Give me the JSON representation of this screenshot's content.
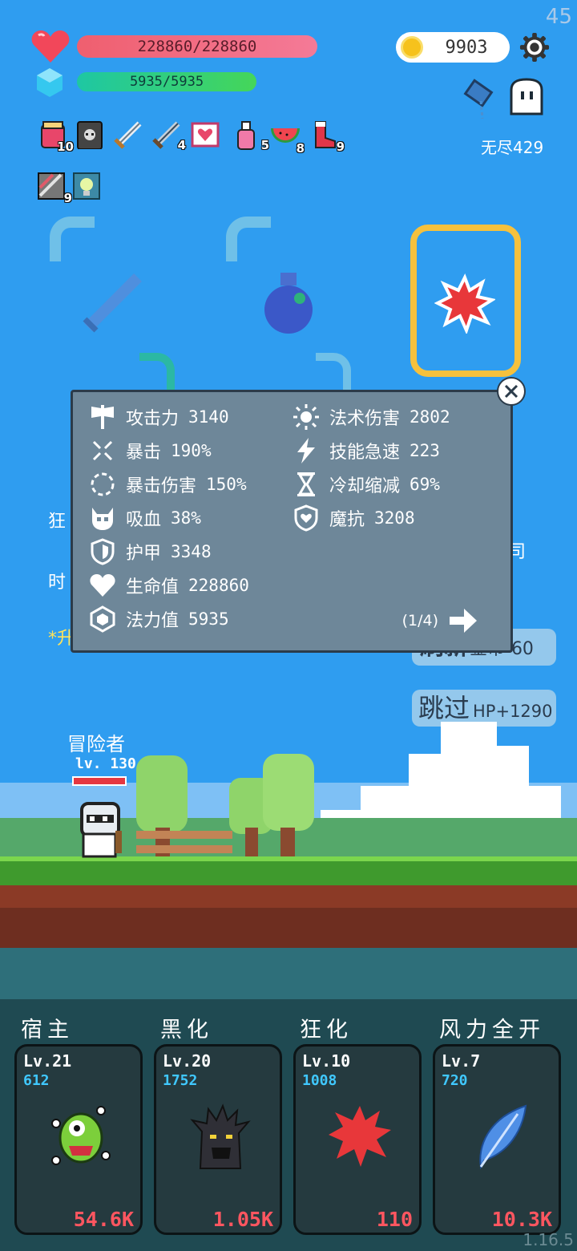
{
  "fps": "45",
  "version": "1.16.5",
  "player": {
    "hp_text": "228860/228860",
    "mp_text": "5935/5935",
    "hp_fill": 1.0,
    "mp_fill": 1.0
  },
  "coins": "9903",
  "endless_label": "无尽429",
  "items": [
    {
      "icon": "potion-jar-icon",
      "count": "10"
    },
    {
      "icon": "skull-book-icon",
      "count": ""
    },
    {
      "icon": "sword-icon",
      "count": ""
    },
    {
      "icon": "sword-icon",
      "count": "4"
    },
    {
      "icon": "heart-card-icon",
      "count": ""
    },
    {
      "icon": "pink-bottle-icon",
      "count": "5"
    },
    {
      "icon": "watermelon-icon",
      "count": "8"
    },
    {
      "icon": "red-boot-icon",
      "count": "9"
    },
    {
      "icon": "striped-card-icon",
      "count": "9"
    },
    {
      "icon": "lightbulb-icon",
      "count": ""
    }
  ],
  "stats_panel": {
    "left": [
      {
        "icon": "axe-icon",
        "label": "攻击力",
        "value": "3140"
      },
      {
        "icon": "crit-icon",
        "label": "暴击",
        "value": "190%"
      },
      {
        "icon": "crit-damage-icon",
        "label": "暴击伤害",
        "value": "150%"
      },
      {
        "icon": "vampire-icon",
        "label": "吸血",
        "value": "38%"
      },
      {
        "icon": "armor-icon",
        "label": "护甲",
        "value": "3348"
      },
      {
        "icon": "heart-icon",
        "label": "生命值",
        "value": "228860"
      },
      {
        "icon": "mana-crystal-icon",
        "label": "法力值",
        "value": "5935"
      }
    ],
    "right": [
      {
        "icon": "sun-icon",
        "label": "法术伤害",
        "value": "2802"
      },
      {
        "icon": "lightning-icon",
        "label": "技能急速",
        "value": "223"
      },
      {
        "icon": "hourglass-icon",
        "label": "冷却缩减",
        "value": "69%"
      },
      {
        "icon": "magic-shield-icon",
        "label": "魔抗",
        "value": "3208"
      }
    ],
    "page": "(1/4)"
  },
  "partial_texts": {
    "left1": "狂",
    "left2": "时",
    "left3": "*升",
    "right1": "司"
  },
  "buttons": {
    "refresh_label": "刷新",
    "refresh_cost": "金币-60",
    "skip_label": "跳过",
    "skip_reward": "HP+1290"
  },
  "hero": {
    "name": "冒险者",
    "level": "lv. 130",
    "hp_fill": 1.0
  },
  "skills": [
    {
      "title": "宿主",
      "level": "Lv.21",
      "number": "612",
      "cost": "54.6K",
      "icon": "green-virus-monster-icon"
    },
    {
      "title": "黑化",
      "level": "Lv.20",
      "number": "1752",
      "cost": "1.05K",
      "icon": "dark-tree-monster-icon"
    },
    {
      "title": "狂化",
      "level": "Lv.10",
      "number": "1008",
      "cost": "110",
      "icon": "red-splat-icon"
    },
    {
      "title": "风力全开",
      "level": "Lv.7",
      "number": "720",
      "cost": "10.3K",
      "icon": "blue-feather-icon"
    }
  ]
}
